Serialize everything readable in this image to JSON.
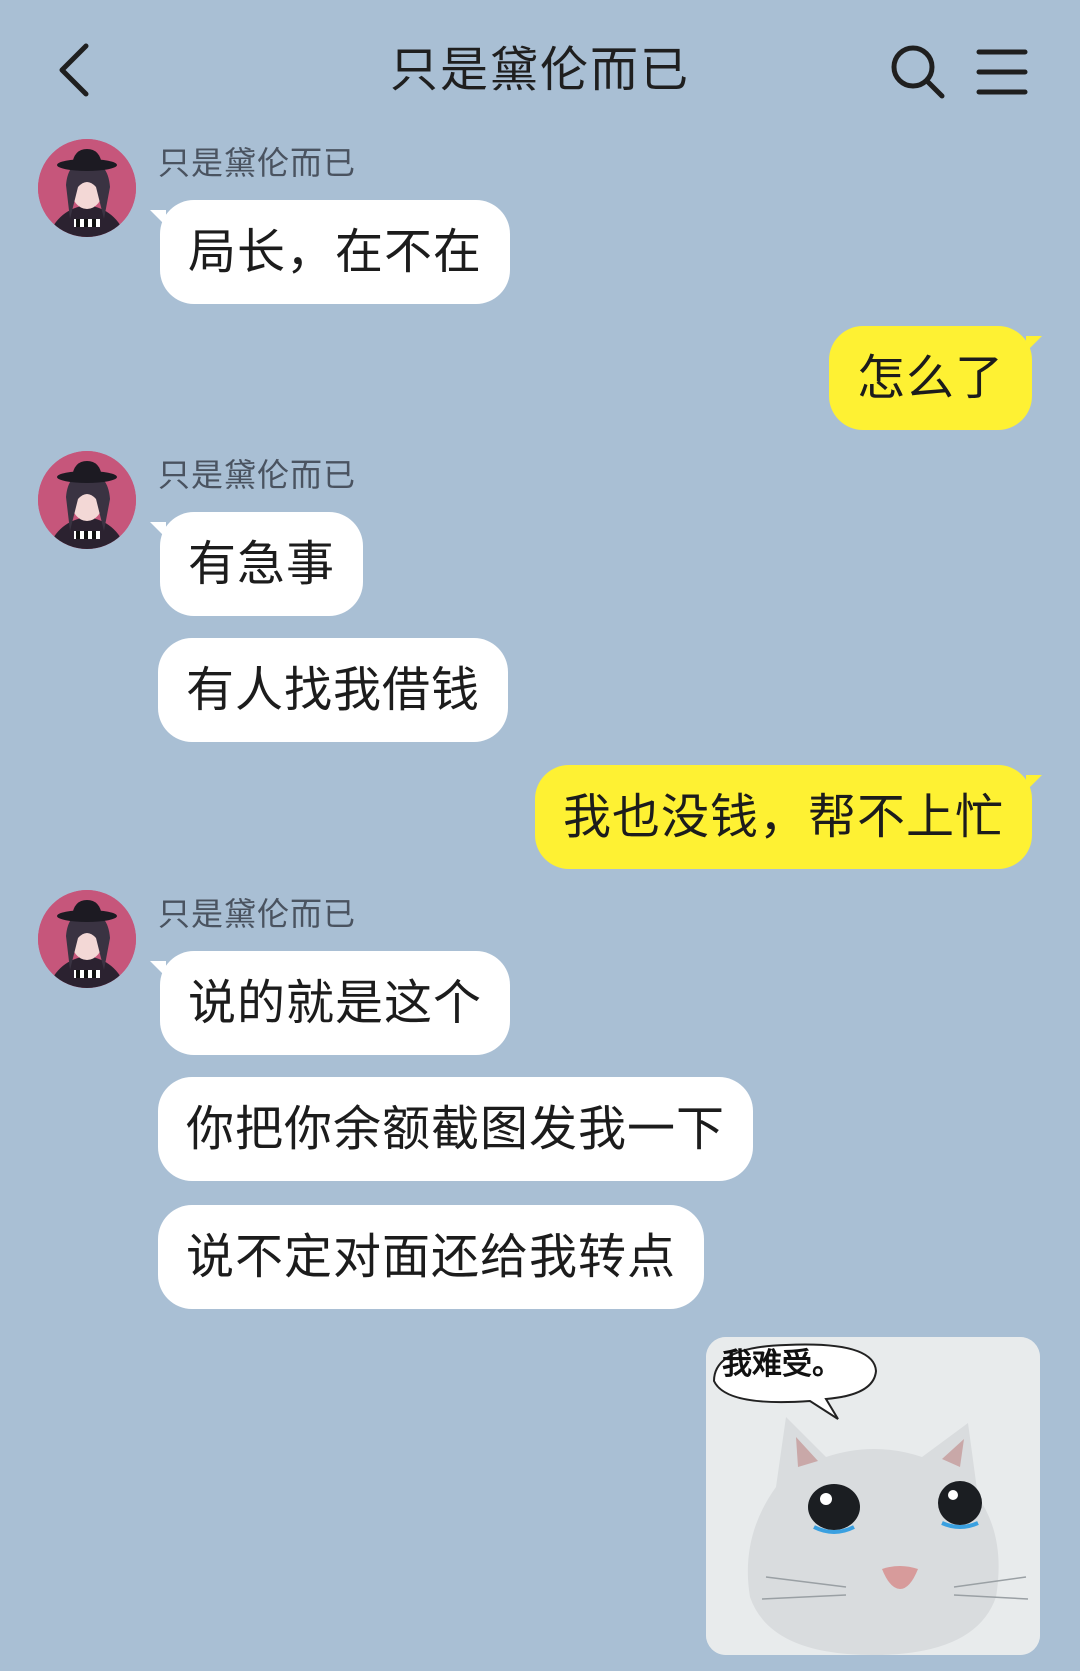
{
  "header": {
    "title": "只是黛伦而已",
    "back_icon": "chevron-left-icon",
    "search_icon": "search-icon",
    "menu_icon": "hamburger-menu-icon"
  },
  "colors": {
    "background": "#a9bfd4",
    "incoming_bubble": "#ffffff",
    "outgoing_bubble": "#fef133"
  },
  "messages": [
    {
      "sender": "只是黛伦而已",
      "direction": "incoming",
      "text": "局长，在不在"
    },
    {
      "direction": "outgoing",
      "text": "怎么了"
    },
    {
      "sender": "只是黛伦而已",
      "direction": "incoming",
      "text": "有急事"
    },
    {
      "direction": "incoming",
      "text": "有人找我借钱"
    },
    {
      "direction": "outgoing",
      "text": "我也没钱，帮不上忙"
    },
    {
      "sender": "只是黛伦而已",
      "direction": "incoming",
      "text": "说的就是这个"
    },
    {
      "direction": "incoming",
      "text": "你把你余额截图发我一下"
    },
    {
      "direction": "incoming",
      "text": "说不定对面还给我转点"
    },
    {
      "direction": "outgoing",
      "type": "sticker",
      "caption": "我难受。"
    }
  ]
}
